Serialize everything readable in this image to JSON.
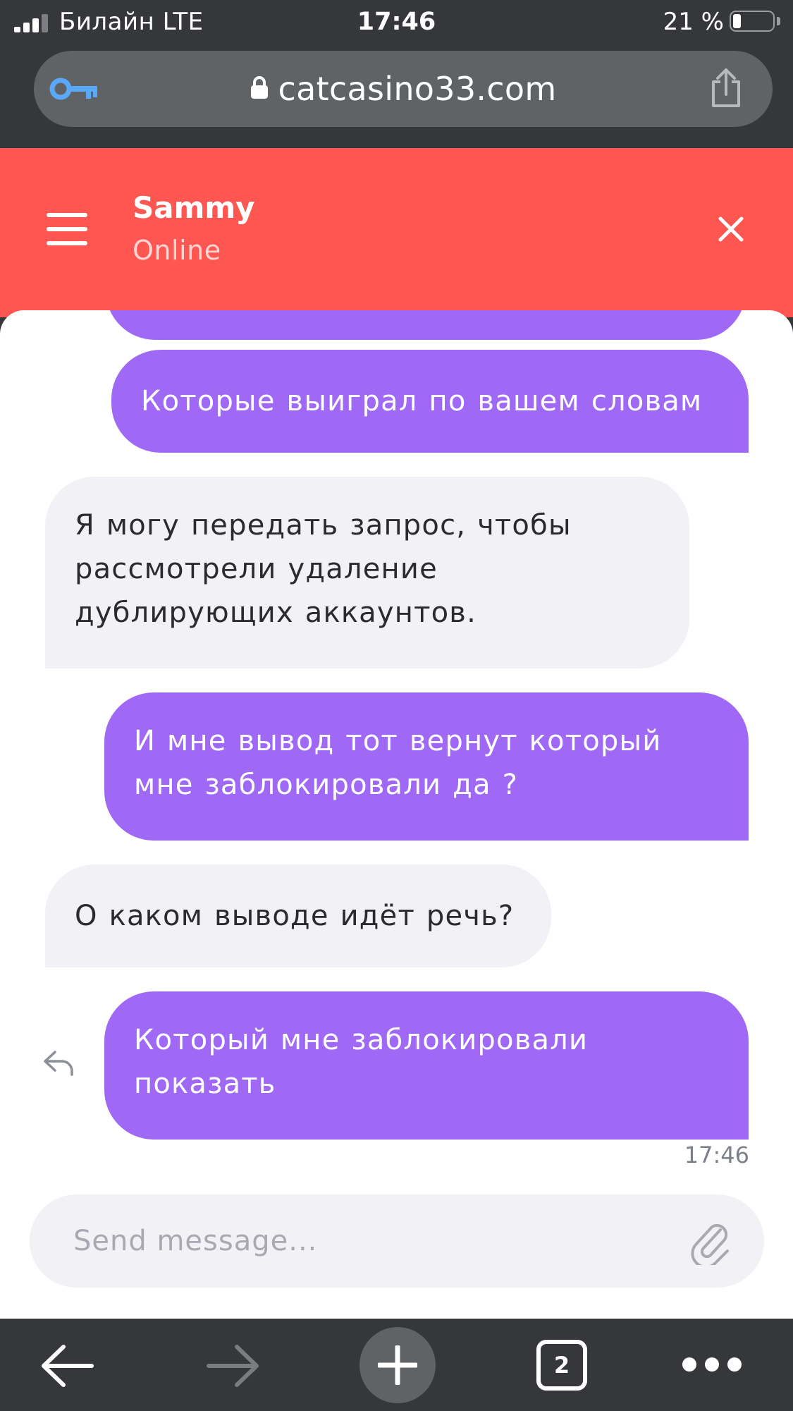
{
  "status_bar": {
    "carrier": "Билайн  LTE",
    "time": "17:46",
    "battery_percent": "21 %",
    "battery_level": 0.21,
    "signal_bars": 3
  },
  "browser": {
    "url": "catcasino33.com",
    "open_tabs": "2",
    "icons": [
      "key-icon",
      "lock-icon",
      "share-icon",
      "back-arrow-icon",
      "forward-arrow-icon",
      "plus-icon",
      "more-icon"
    ]
  },
  "chat": {
    "agent_name": "Sammy",
    "agent_status": "Online",
    "messages": [
      {
        "from": "user",
        "text": ""
      },
      {
        "from": "user",
        "text": "Которые выиграл по вашем словам"
      },
      {
        "from": "agent",
        "text": "Я могу передать запрос, чтобы рассмотрели удаление дублирующих аккаунтов."
      },
      {
        "from": "user",
        "text": "И мне вывод тот вернут который мне заблокировали да ?"
      },
      {
        "from": "agent",
        "text": "О каком выводе идёт речь?"
      },
      {
        "from": "user",
        "text": "Который мне заблокировали показать"
      }
    ],
    "last_message_time": "17:46",
    "composer": {
      "placeholder": "Send message...",
      "value": ""
    }
  },
  "colors": {
    "header": "#fe5650",
    "outgoing_bubble": "#9f68f5",
    "incoming_bubble": "#f2f2f6",
    "browser_chrome": "#35373b",
    "url_field": "#5f6366"
  }
}
